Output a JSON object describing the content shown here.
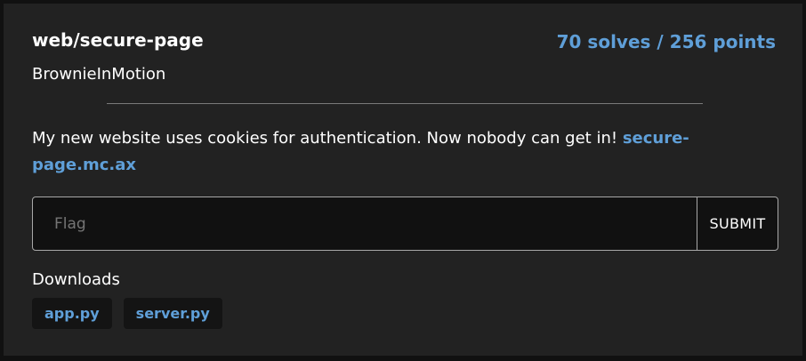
{
  "challenge": {
    "title": "web/secure-page",
    "stats": "70 solves / 256 points",
    "author": "BrownieInMotion",
    "description_text": "My new website uses cookies for authentication. Now nobody can get in!",
    "description_link": "secure-page.mc.ax"
  },
  "flag_form": {
    "placeholder": "Flag",
    "value": "",
    "submit_label": "SUBMIT"
  },
  "downloads": {
    "label": "Downloads",
    "files": [
      "app.py",
      "server.py"
    ]
  },
  "colors": {
    "background": "#111111",
    "card": "#222222",
    "accent": "#5f9fd8",
    "text": "#ffffff"
  }
}
